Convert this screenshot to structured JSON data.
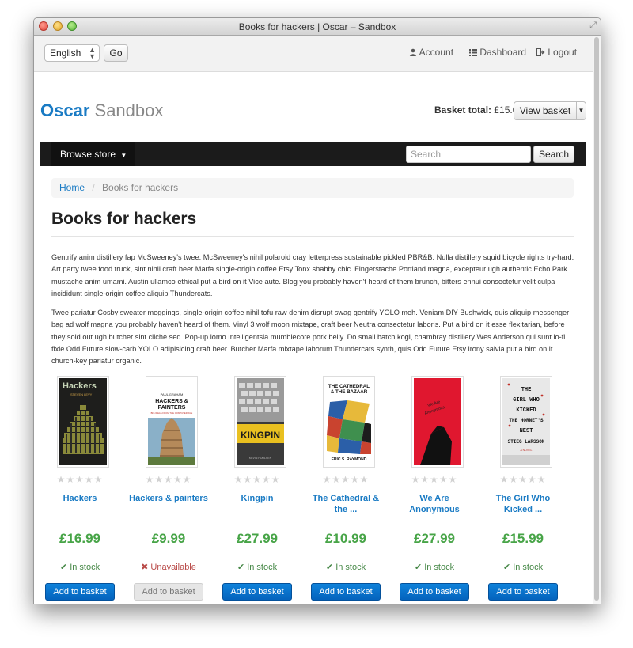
{
  "window": {
    "title": "Books for hackers | Oscar – Sandbox"
  },
  "topbar": {
    "language": "English",
    "go_label": "Go",
    "account_label": "Account",
    "dashboard_label": "Dashboard",
    "logout_label": "Logout"
  },
  "header": {
    "brand_main": "Oscar",
    "brand_sub": "Sandbox",
    "basket_label": "Basket total:",
    "basket_total": "£15.00",
    "view_basket_label": "View basket"
  },
  "navbar": {
    "browse_label": "Browse store",
    "search_placeholder": "Search",
    "search_button": "Search"
  },
  "breadcrumb": {
    "home": "Home",
    "current": "Books for hackers"
  },
  "page": {
    "title": "Books for hackers",
    "description": [
      "Gentrify anim distillery fap McSweeney's twee. McSweeney's nihil polaroid cray letterpress sustainable pickled PBR&B. Nulla distillery squid bicycle rights try-hard. Art party twee food truck, sint nihil craft beer Marfa single-origin coffee Etsy Tonx shabby chic. Fingerstache Portland magna, excepteur ugh authentic Echo Park mustache anim umami. Austin ullamco ethical put a bird on it Vice aute. Blog you probably haven't heard of them brunch, bitters ennui consectetur velit culpa incididunt single-origin coffee aliquip Thundercats.",
      "Twee pariatur Cosby sweater meggings, single-origin coffee nihil tofu raw denim disrupt swag gentrify YOLO meh. Veniam DIY Bushwick, quis aliquip messenger bag ad wolf magna you probably haven't heard of them. Vinyl 3 wolf moon mixtape, craft beer Neutra consectetur laboris. Put a bird on it esse flexitarian, before they sold out ugh butcher sint cliche sed. Pop-up lomo Intelligentsia mumblecore pork belly. Do small batch kogi, chambray distillery Wes Anderson qui sunt lo-fi fixie Odd Future slow-carb YOLO adipisicing craft beer. Butcher Marfa mixtape laborum Thundercats synth, quis Odd Future Etsy irony salvia put a bird on it church-key pariatur organic."
    ]
  },
  "covers": {
    "hackers": {
      "title": "Hackers",
      "author": "STEVEN LEVY"
    },
    "painters": {
      "title_1": "HACKERS &",
      "title_2": "PAINTERS",
      "author": "PAUL GRAHAM",
      "tagline": "BIG IDEAS FROM THE COMPUTER AGE"
    },
    "kingpin": {
      "title": "KINGPIN",
      "author": "KEVIN POULSEN"
    },
    "cathedral": {
      "title_1": "THE CATHEDRAL",
      "title_2": "& THE BAZAAR",
      "author": "ERIC S. RAYMOND"
    },
    "anonymous": {
      "title_1": "We Are",
      "title_2": "Anonymous"
    },
    "dragon": {
      "line_1": "THE",
      "line_2": "GIRL WHO",
      "line_3": "KICKED",
      "line_4": "THE HORNET'S",
      "line_5": "NEST",
      "author": "STIEG LARSSON",
      "tagline": "A NOVEL"
    }
  },
  "products": [
    {
      "title": "Hackers",
      "price": "£16.99",
      "availability": "In stock",
      "in_stock": true,
      "rating": 0,
      "button": "Add to basket"
    },
    {
      "title": "Hackers & painters",
      "price": "£9.99",
      "availability": "Unavailable",
      "in_stock": false,
      "rating": 0,
      "button": "Add to basket"
    },
    {
      "title": "Kingpin",
      "price": "£27.99",
      "availability": "In stock",
      "in_stock": true,
      "rating": 0,
      "button": "Add to basket"
    },
    {
      "title": "The Cathedral & the ...",
      "price": "£10.99",
      "availability": "In stock",
      "in_stock": true,
      "rating": 0,
      "button": "Add to basket"
    },
    {
      "title": "We Are Anonymous",
      "price": "£27.99",
      "availability": "In stock",
      "in_stock": true,
      "rating": 0,
      "button": "Add to basket"
    },
    {
      "title": "The Girl Who Kicked ...",
      "price": "£15.99",
      "availability": "In stock",
      "in_stock": true,
      "rating": 0,
      "button": "Add to basket"
    }
  ],
  "icons": {
    "star": "★",
    "check": "✔",
    "cross": "✖",
    "user": "user-icon",
    "list": "list-icon",
    "logout": "logout-icon"
  },
  "colors": {
    "link": "#1a7bc4",
    "price": "#47a447",
    "in_stock": "#468847",
    "unavailable": "#b94a48",
    "button_primary": "#0463bd",
    "navbar": "#1b1b1b"
  }
}
